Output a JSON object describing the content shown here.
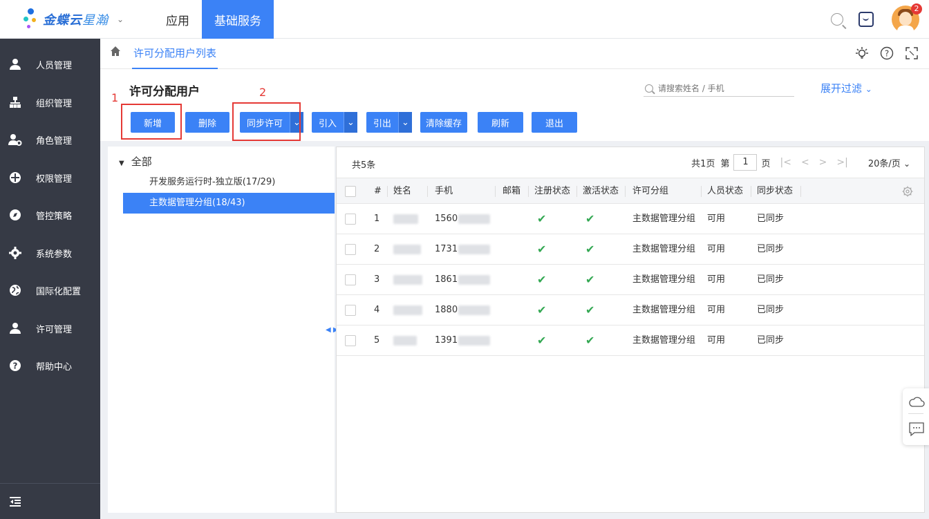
{
  "app": {
    "brand": "金蝶云",
    "brand_sub": "星瀚",
    "nav": [
      "应用",
      "基础服务"
    ],
    "active_nav": "基础服务",
    "notification_count": "2"
  },
  "sidebar": {
    "items": [
      {
        "label": "人员管理",
        "icon": "person-icon"
      },
      {
        "label": "组织管理",
        "icon": "org-icon"
      },
      {
        "label": "角色管理",
        "icon": "role-icon"
      },
      {
        "label": "权限管理",
        "icon": "shield-icon"
      },
      {
        "label": "管控策略",
        "icon": "compass-icon"
      },
      {
        "label": "系统参数",
        "icon": "gear-icon"
      },
      {
        "label": "国际化配置",
        "icon": "globe-icon"
      },
      {
        "label": "许可管理",
        "icon": "license-icon"
      },
      {
        "label": "帮助中心",
        "icon": "help-icon"
      }
    ]
  },
  "breadcrumb": {
    "tab": "许可分配用户列表"
  },
  "page": {
    "title": "许可分配用户",
    "search_placeholder": "请搜索姓名 / 手机",
    "expand_filter": "展开过滤"
  },
  "toolbar": {
    "add": "新增",
    "delete": "删除",
    "sync_license": "同步许可",
    "import": "引入",
    "export": "引出",
    "clear_cache": "清除缓存",
    "refresh": "刷新",
    "exit": "退出"
  },
  "annotations": {
    "mark1": "1",
    "mark2": "2"
  },
  "tree": {
    "root": "全部",
    "nodes": [
      "开发服务运行时-独立版(17/29)",
      "主数据管理分组(18/43)"
    ]
  },
  "grid": {
    "total": "共5条",
    "pager": {
      "pages": "共1页",
      "page_prefix": "第",
      "page": "1",
      "page_suffix": "页",
      "page_size": "20条/页"
    },
    "columns": [
      "#",
      "姓名",
      "手机",
      "邮箱",
      "注册状态",
      "激活状态",
      "许可分组",
      "人员状态",
      "同步状态"
    ],
    "rows": [
      {
        "no": "1",
        "phone": "1560",
        "group": "主数据管理分组",
        "person_status": "可用",
        "sync_status": "已同步"
      },
      {
        "no": "2",
        "phone": "1731",
        "group": "主数据管理分组",
        "person_status": "可用",
        "sync_status": "已同步"
      },
      {
        "no": "3",
        "phone": "1861",
        "group": "主数据管理分组",
        "person_status": "可用",
        "sync_status": "已同步"
      },
      {
        "no": "4",
        "phone": "1880",
        "group": "主数据管理分组",
        "person_status": "可用",
        "sync_status": "已同步"
      },
      {
        "no": "5",
        "phone": "1391",
        "group": "主数据管理分组",
        "person_status": "可用",
        "sync_status": "已同步"
      }
    ]
  },
  "colors": {
    "accent": "#3b82f6",
    "sidebar": "#363a45",
    "check": "#34a853",
    "annotation": "#e53935"
  }
}
